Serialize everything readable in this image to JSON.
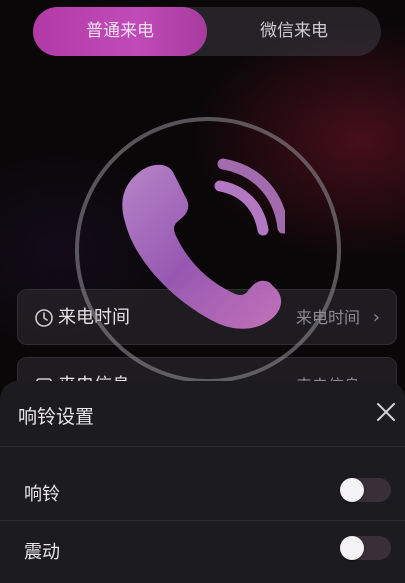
{
  "tabs": {
    "active_label": "普通来电",
    "inactive_label": "微信来电"
  },
  "hero": {
    "icon": "phone-icon"
  },
  "rows": [
    {
      "label": "来电时间",
      "value": "来电时间",
      "icon": "clock-icon"
    },
    {
      "label": "来电信息",
      "value": "来电信息",
      "icon": "message-icon"
    }
  ],
  "ringtone_sheet": {
    "title": "响铃设置",
    "close_icon": "close-icon",
    "settings": [
      {
        "label": "响铃",
        "enabled": false
      },
      {
        "label": "震动",
        "enabled": false
      }
    ]
  },
  "colors": {
    "accent": "#b23aa6",
    "sheet_bg": "#1c1b20"
  }
}
